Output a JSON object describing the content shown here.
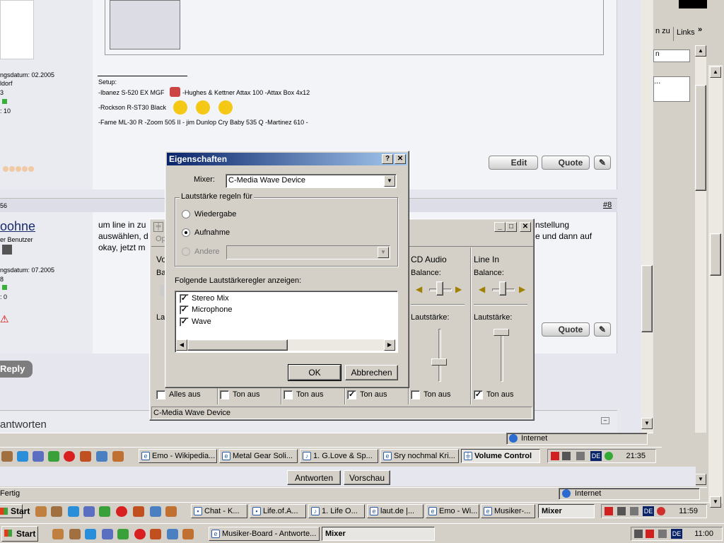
{
  "forum": {
    "post1": {
      "join_date": "ngsdatum: 02.2005",
      "location": "ldorf",
      "posts_num": "3",
      "rating": ": 10",
      "setup_label": "Setup:",
      "setup_line1a": "-Ibanez S-520 EX MGF",
      "setup_line1b": "-Hughes & Kettner Attax 100 -Attax Box 4x12",
      "setup_line2": "-Rockson R-ST30 Black",
      "setup_line3": "-Fame ML-30 R -Zoom 505 II - jim Dunlop Cry Baby 535 Q -Martinez 610 -",
      "edit_label": "Edit",
      "quote_label": "Quote"
    },
    "post2": {
      "timestamp_frag": "56",
      "post_number": "#8",
      "username": "oohne",
      "rank": "er Benutzer",
      "join_date": "ngsdatum: 07.2005",
      "posts_num": "8",
      "rating": ": 0",
      "body_line1_left": "um line in zu",
      "body_line1_right": "nstellung",
      "body_line2_left": "auswählen, d",
      "body_line2_right": "e und dann auf",
      "body_line3_left": "okay, jetzt m",
      "quote_label": "Quote"
    },
    "reply_label": "Reply",
    "antworten_heading": "antworten"
  },
  "browser": {
    "links_label": "Links",
    "zu_label": "n zu",
    "status_internet": "Internet",
    "status_fertig": "Fertig",
    "antworten_button": "Antworten",
    "vorschau_button": "Vorschau"
  },
  "volume_control": {
    "title": "",
    "menu_fragment": "Op",
    "frag_vo": "Vo",
    "frag_ba": "Ba",
    "frag_la": "La",
    "channels": [
      {
        "name": "CD Audio",
        "balance": "Balance:",
        "volume": "Lautstärke:",
        "mute": "Ton aus",
        "muted": false
      },
      {
        "name": "Line In",
        "balance": "Balance:",
        "volume": "Lautstärke:",
        "mute": "Ton aus",
        "muted": true
      }
    ],
    "bottom_mutes": [
      {
        "label": "Alles aus",
        "checked": false
      },
      {
        "label": "Ton aus",
        "checked": false
      },
      {
        "label": "Ton aus",
        "checked": false
      },
      {
        "label": "Ton aus",
        "checked": true
      }
    ],
    "status": "C-Media Wave Device"
  },
  "dialog": {
    "title": "Eigenschaften",
    "help": "?",
    "close": "✕",
    "mixer_label": "Mixer:",
    "mixer_value": "C-Media Wave Device",
    "group1_label": "Lautstärke regeln für",
    "radio_playback": "Wiedergabe",
    "radio_recording": "Aufnahme",
    "radio_other": "Andere",
    "selected_mode": "Aufnahme",
    "list_label": "Folgende Lautstärkeregler anzeigen:",
    "controls": [
      {
        "label": "Stereo Mix",
        "checked": true
      },
      {
        "label": "Microphone",
        "checked": true
      },
      {
        "label": "Wave",
        "checked": true
      }
    ],
    "ok": "OK",
    "cancel": "Abbrechen"
  },
  "taskbar1": {
    "items": [
      "Emo - Wikipedia...",
      "Metal Gear Soli...",
      "1. G.Love & Sp...",
      "Sry nochmal Kri...",
      "Volume Control"
    ],
    "active": "Volume Control",
    "clock": "21:35"
  },
  "taskbar2": {
    "start": "Start",
    "items": [
      "Chat - K...",
      "Life.of.A...",
      "1. Life O...",
      "laut.de |...",
      "Emo - Wi...",
      "Musiker-..."
    ],
    "mixer": "Mixer",
    "clock": "11:59"
  },
  "taskbar3": {
    "start": "Start",
    "items": [
      "Musiker-Board - Antworte..."
    ],
    "mixer": "Mixer",
    "lang": "DE",
    "clock": "11:00"
  },
  "colors": {
    "title_active": "#0a246a",
    "desktop": "#d4d0c8",
    "forum_bg": "#e9ebf1"
  }
}
